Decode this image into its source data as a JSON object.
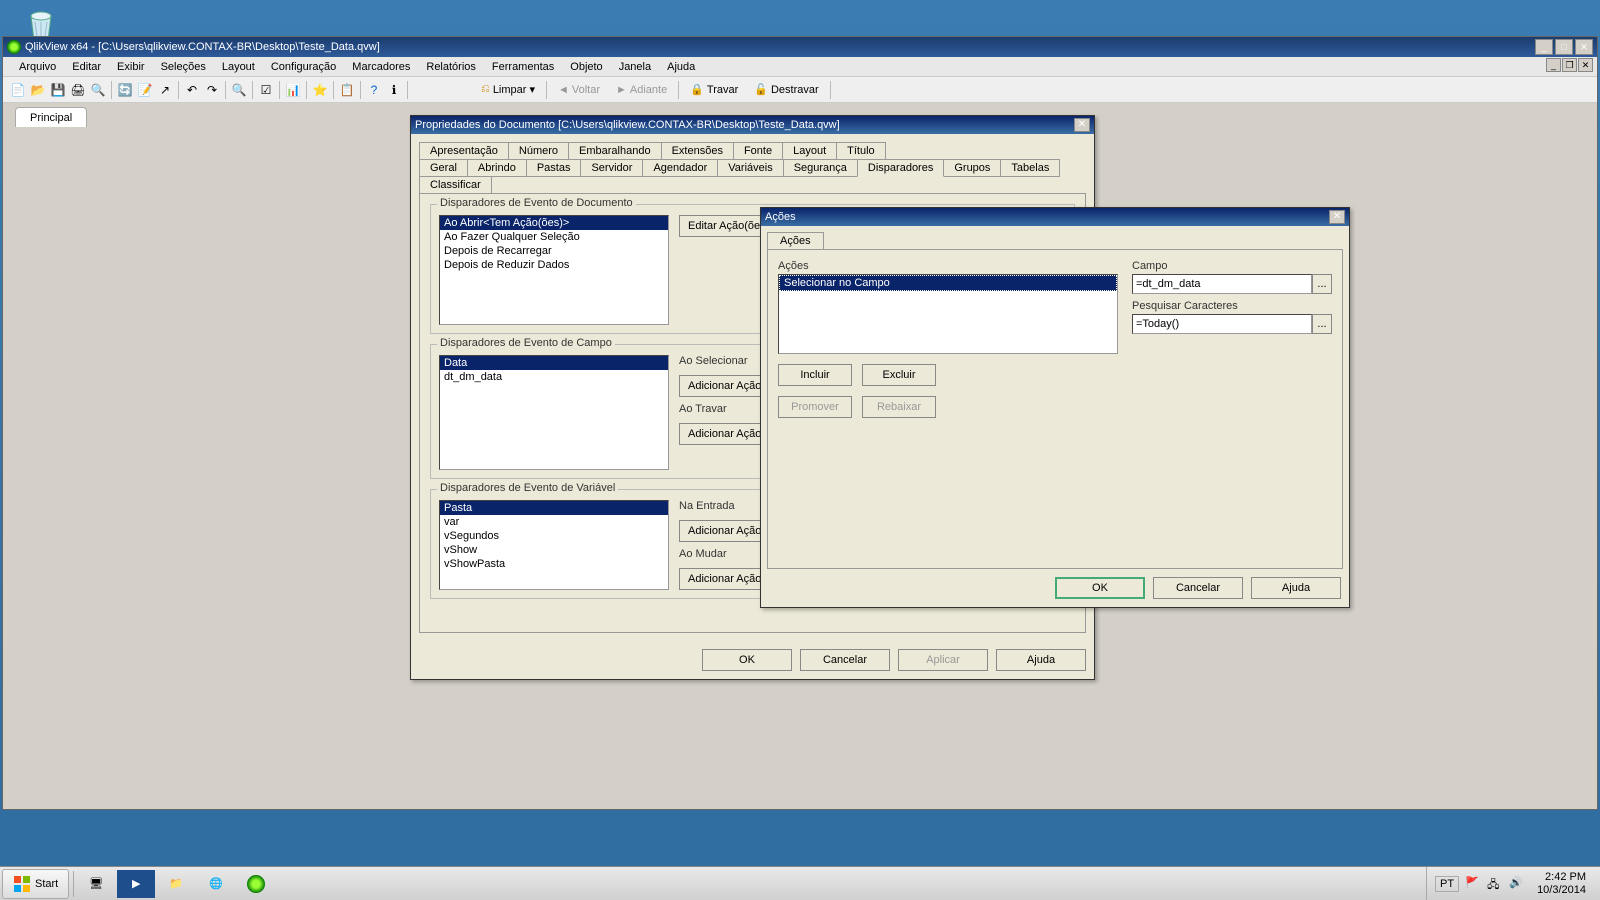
{
  "desktop": {
    "recycle_label": ""
  },
  "app": {
    "title": "QlikView x64 - [C:\\Users\\qlikview.CONTAX-BR\\Desktop\\Teste_Data.qvw]",
    "menu": [
      "Arquivo",
      "Editar",
      "Exibir",
      "Seleções",
      "Layout",
      "Configuração",
      "Marcadores",
      "Relatórios",
      "Ferramentas",
      "Objeto",
      "Janela",
      "Ajuda"
    ],
    "toolbar2": {
      "limpar": "Limpar",
      "voltar": "Voltar",
      "adiante": "Adiante",
      "travar": "Travar",
      "destravar": "Destravar"
    },
    "tab": "Principal"
  },
  "propDlg": {
    "title": "Propriedades do Documento [C:\\Users\\qlikview.CONTAX-BR\\Desktop\\Teste_Data.qvw]",
    "tabsTop": [
      "Apresentação",
      "Número",
      "Embaralhando",
      "Extensões",
      "Fonte",
      "Layout",
      "Título"
    ],
    "tabsBottom": [
      "Geral",
      "Abrindo",
      "Pastas",
      "Servidor",
      "Agendador",
      "Variáveis",
      "Segurança",
      "Disparadores",
      "Grupos",
      "Tabelas",
      "Classificar"
    ],
    "activeTab": "Disparadores",
    "sec1": {
      "title": "Disparadores de Evento de Documento",
      "items": [
        "Ao Abrir<Tem Ação(ões)>",
        "Ao Fazer Qualquer Seleção",
        "Depois de Recarregar",
        "Depois de Reduzir Dados"
      ],
      "editBtn": "Editar Ação(ões)..."
    },
    "sec2": {
      "title": "Disparadores de Evento de Campo",
      "items": [
        "Data",
        "dt_dm_data"
      ],
      "lbl1": "Ao Selecionar",
      "btn1": "Adicionar Ação(ões",
      "lbl2": "Ao Travar",
      "btn2": "Adicionar Ação(ões"
    },
    "sec3": {
      "title": "Disparadores de Evento de Variável",
      "items": [
        "Pasta",
        "var",
        "vSegundos",
        "vShow",
        "vShowPasta"
      ],
      "lbl1": "Na Entrada",
      "btn1": "Adicionar Ação(ões",
      "lbl2": "Ao Mudar",
      "btn2": "Adicionar Ação(ões"
    },
    "buttons": {
      "ok": "OK",
      "cancel": "Cancelar",
      "apply": "Aplicar",
      "help": "Ajuda"
    }
  },
  "actDlg": {
    "title": "Ações",
    "tab": "Ações",
    "actionsLabel": "Ações",
    "actionItem": "Selecionar no Campo",
    "campoLabel": "Campo",
    "campoVal": "=dt_dm_data",
    "pesqLabel": "Pesquisar Caracteres",
    "pesqVal": "=Today()",
    "btns": {
      "incluir": "Incluir",
      "excluir": "Excluir",
      "promover": "Promover",
      "rebaixar": "Rebaixar"
    },
    "footer": {
      "ok": "OK",
      "cancel": "Cancelar",
      "help": "Ajuda"
    }
  },
  "taskbar": {
    "start": "Start",
    "lang": "PT",
    "time": "2:42 PM",
    "date": "10/3/2014"
  }
}
